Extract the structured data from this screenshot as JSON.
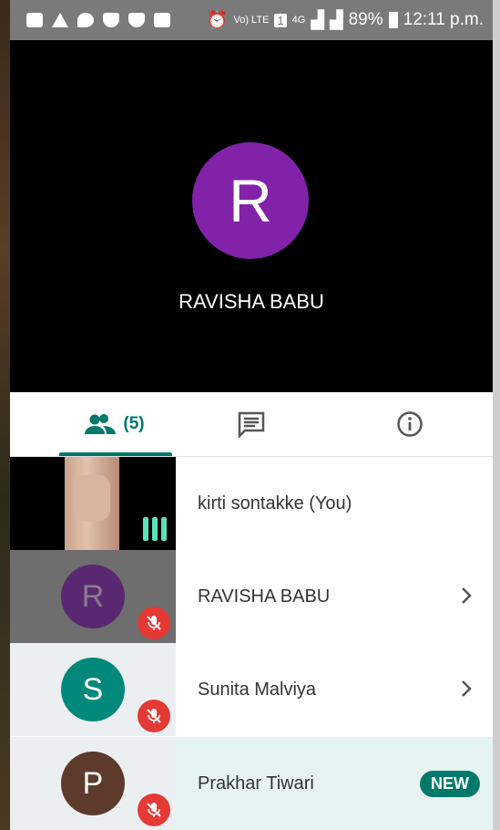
{
  "status_bar": {
    "lte": "Vo) LTE",
    "sim": "1",
    "net": "4G",
    "battery": "89%",
    "time": "12:11 p.m."
  },
  "main_speaker": {
    "initial": "R",
    "name": "RAVISHA BABU",
    "avatar_color": "#8222a9"
  },
  "tabs": {
    "people_count": "(5)"
  },
  "participants": [
    {
      "name": "kirti sontakke (You)",
      "speaking": true
    },
    {
      "initial": "R",
      "name": "RAVISHA BABU",
      "avatar_color": "#5a2870",
      "muted": true
    },
    {
      "initial": "S",
      "name": "Sunita Malviya",
      "avatar_color": "#00897b",
      "muted": true
    },
    {
      "initial": "P",
      "name": "Prakhar Tiwari",
      "avatar_color": "#5d3a2c",
      "muted": true,
      "badge": "NEW"
    }
  ],
  "colors": {
    "accent": "#00796b",
    "mute_red": "#e53935"
  }
}
